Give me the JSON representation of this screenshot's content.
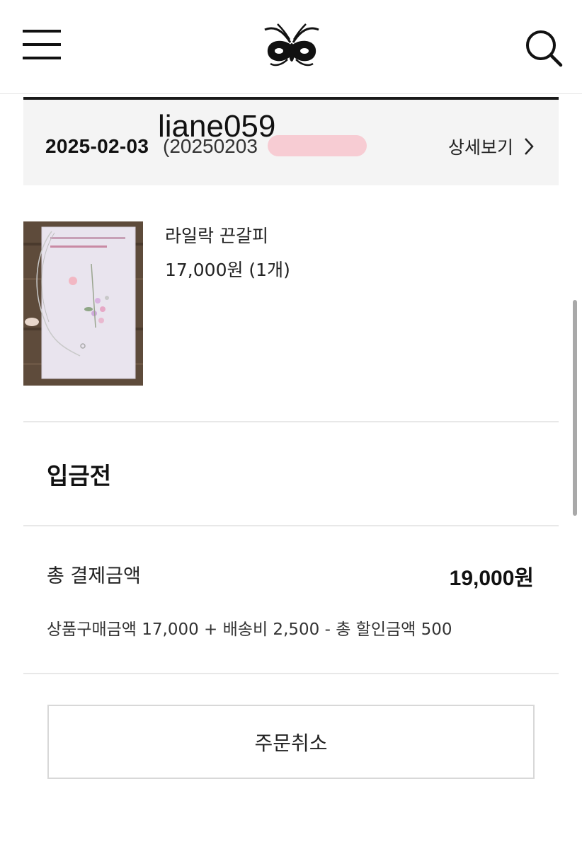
{
  "header": {
    "menu_icon": "hamburger-menu-icon",
    "logo": "butterfly-logo",
    "search_icon": "search-icon"
  },
  "order": {
    "date": "2025-02-03",
    "order_number_partial": "(20250203",
    "overlay_text": "liane059",
    "detail_label": "상세보기",
    "detail_icon": "chevron-right-icon"
  },
  "product": {
    "name": "라일락 끈갈피",
    "price_qty": "17,000원 (1개)"
  },
  "status": {
    "label": "입금전"
  },
  "payment": {
    "total_label": "총 결제금액",
    "total_value": "19,000원",
    "breakdown": "상품구매금액 17,000 + 배송비 2,500 - 총 할인금액 500"
  },
  "actions": {
    "cancel_label": "주문취소"
  },
  "colors": {
    "accent_dark": "#1a1a1a",
    "card_bg": "#f4f4f4",
    "redaction": "#f7c9d1"
  }
}
